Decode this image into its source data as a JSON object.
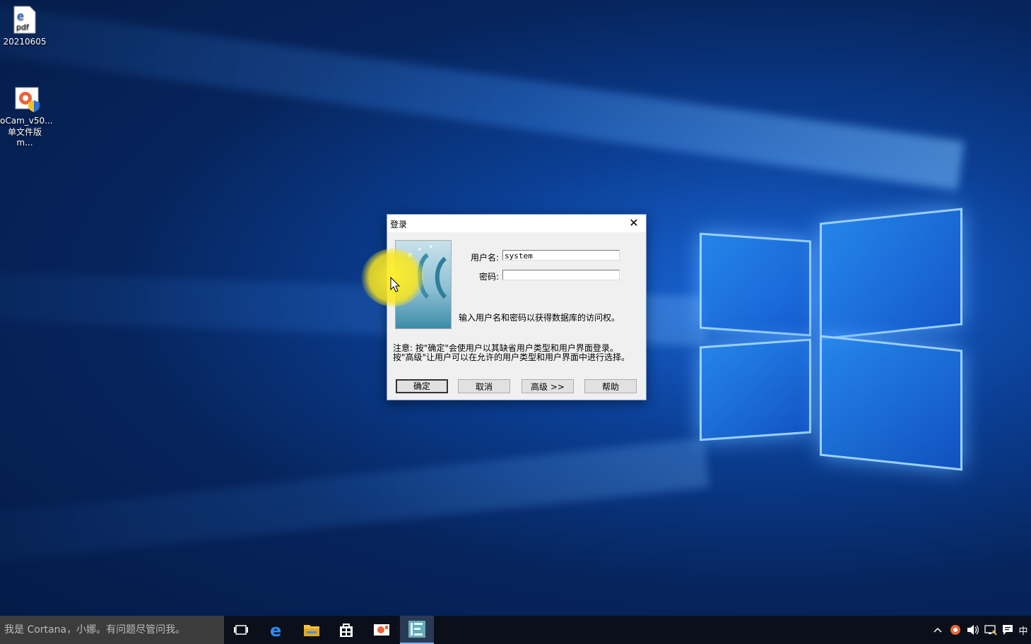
{
  "desktop": {
    "icons": [
      {
        "label": "20210605",
        "icon": "pdf-file-icon"
      },
      {
        "label_line1": "oCam_v50...",
        "label_line2": "单文件版m...",
        "icon": "ocam-installer-icon"
      }
    ]
  },
  "dialog": {
    "title": "登录",
    "username_label": "用户名:",
    "username_value": "system",
    "password_label": "密码:",
    "password_value": "",
    "info": "输入用户名和密码以获得数据库的访问权。",
    "note_line1": "注意: 按\"确定\"会使用户以其缺省用户类型和用户界面登录。",
    "note_line2": "按\"高级\"让用户可以在允许的用户类型和用户界面中进行选择。",
    "buttons": {
      "ok": "确定",
      "cancel": "取消",
      "advanced": "高级 >>",
      "help": "帮助"
    }
  },
  "taskbar": {
    "search_placeholder": "我是 Cortana，小娜。有问题尽管问我。",
    "apps": [
      "task-view-icon",
      "edge-icon",
      "file-explorer-icon",
      "store-icon",
      "ocam-icon",
      "database-app-icon"
    ],
    "tray": {
      "ime": "中"
    }
  },
  "colors": {
    "taskbar": "#0b0f1a",
    "search_box": "#3c3c3c",
    "cursor_highlight": "#f5e61e"
  }
}
